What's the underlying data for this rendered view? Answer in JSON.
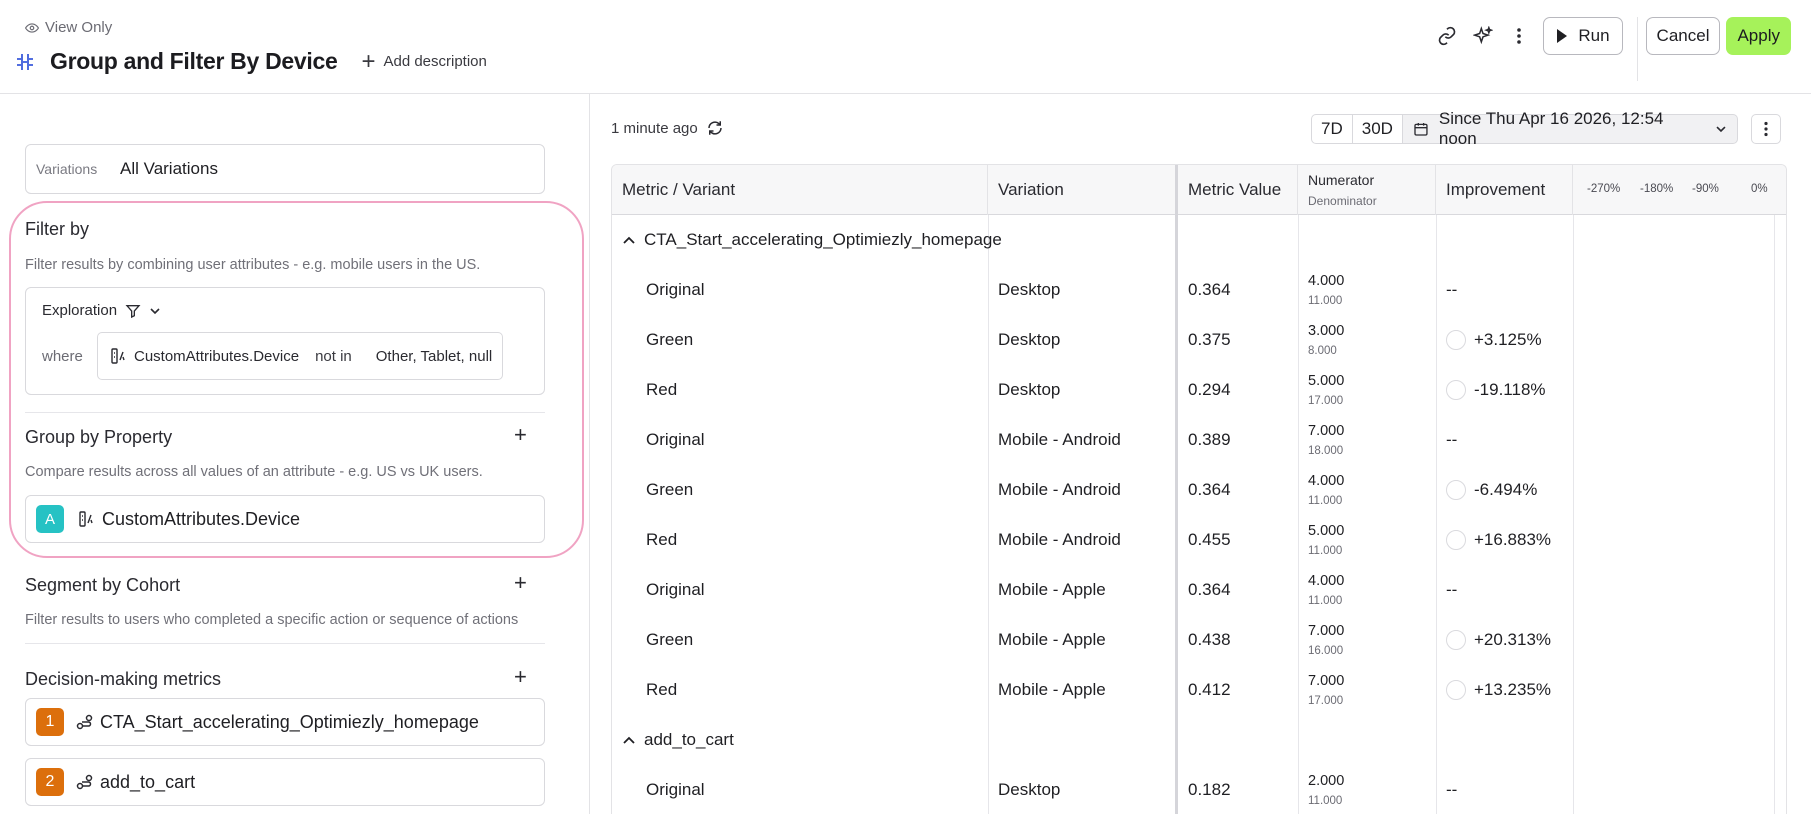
{
  "header": {
    "view_only": "View Only",
    "title": "Group and Filter By Device",
    "add_description": "Add description",
    "run": "Run",
    "cancel": "Cancel",
    "apply": "Apply"
  },
  "left": {
    "variations_label": "Variations",
    "variations_value": "All Variations",
    "filter_title": "Filter by",
    "filter_desc": "Filter results by combining user attributes - e.g. mobile users in the US.",
    "exploration": "Exploration",
    "where": "where",
    "condition_attr": "CustomAttributes.Device",
    "condition_op": "not in",
    "condition_vals": "Other, Tablet, null",
    "group_title": "Group by Property",
    "group_desc": "Compare results across all values of an attribute - e.g. US vs UK users.",
    "group_badge": "A",
    "group_attr": "CustomAttributes.Device",
    "segment_title": "Segment by Cohort",
    "segment_desc": "Filter results to users who completed a specific action or sequence of actions",
    "metrics_title": "Decision-making metrics",
    "metrics": [
      {
        "badge": "1",
        "name": "CTA_Start_accelerating_Optimiezly_homepage"
      },
      {
        "badge": "2",
        "name": "add_to_cart"
      }
    ]
  },
  "right": {
    "updated": "1 minute ago",
    "range_7d": "7D",
    "range_30d": "30D",
    "date_range": "Since Thu Apr 16 2026, 12:54 noon",
    "columns": {
      "metric": "Metric / Variant",
      "variation": "Variation",
      "value": "Metric Value",
      "numerator": "Numerator",
      "denominator": "Denominator",
      "improvement": "Improvement"
    },
    "scale": [
      "-270%",
      "-180%",
      "-90%",
      "0%"
    ],
    "groups": [
      {
        "title": "CTA_Start_accelerating_Optimiezly_homepage"
      },
      {
        "title": "add_to_cart"
      }
    ],
    "rows": [
      {
        "variant": "Original",
        "variation": "Desktop",
        "value": "0.364",
        "num": "4.000",
        "den": "11.000",
        "impr": "--"
      },
      {
        "variant": "Green",
        "variation": "Desktop",
        "value": "0.375",
        "num": "3.000",
        "den": "8.000",
        "impr": "+3.125%"
      },
      {
        "variant": "Red",
        "variation": "Desktop",
        "value": "0.294",
        "num": "5.000",
        "den": "17.000",
        "impr": "-19.118%"
      },
      {
        "variant": "Original",
        "variation": "Mobile - Android",
        "value": "0.389",
        "num": "7.000",
        "den": "18.000",
        "impr": "--"
      },
      {
        "variant": "Green",
        "variation": "Mobile - Android",
        "value": "0.364",
        "num": "4.000",
        "den": "11.000",
        "impr": "-6.494%"
      },
      {
        "variant": "Red",
        "variation": "Mobile - Android",
        "value": "0.455",
        "num": "5.000",
        "den": "11.000",
        "impr": "+16.883%"
      },
      {
        "variant": "Original",
        "variation": "Mobile - Apple",
        "value": "0.364",
        "num": "4.000",
        "den": "11.000",
        "impr": "--"
      },
      {
        "variant": "Green",
        "variation": "Mobile - Apple",
        "value": "0.438",
        "num": "7.000",
        "den": "16.000",
        "impr": "+20.313%"
      },
      {
        "variant": "Red",
        "variation": "Mobile - Apple",
        "value": "0.412",
        "num": "7.000",
        "den": "17.000",
        "impr": "+13.235%"
      },
      {
        "variant": "Original",
        "variation": "Desktop",
        "value": "0.182",
        "num": "2.000",
        "den": "11.000",
        "impr": "--"
      }
    ]
  }
}
